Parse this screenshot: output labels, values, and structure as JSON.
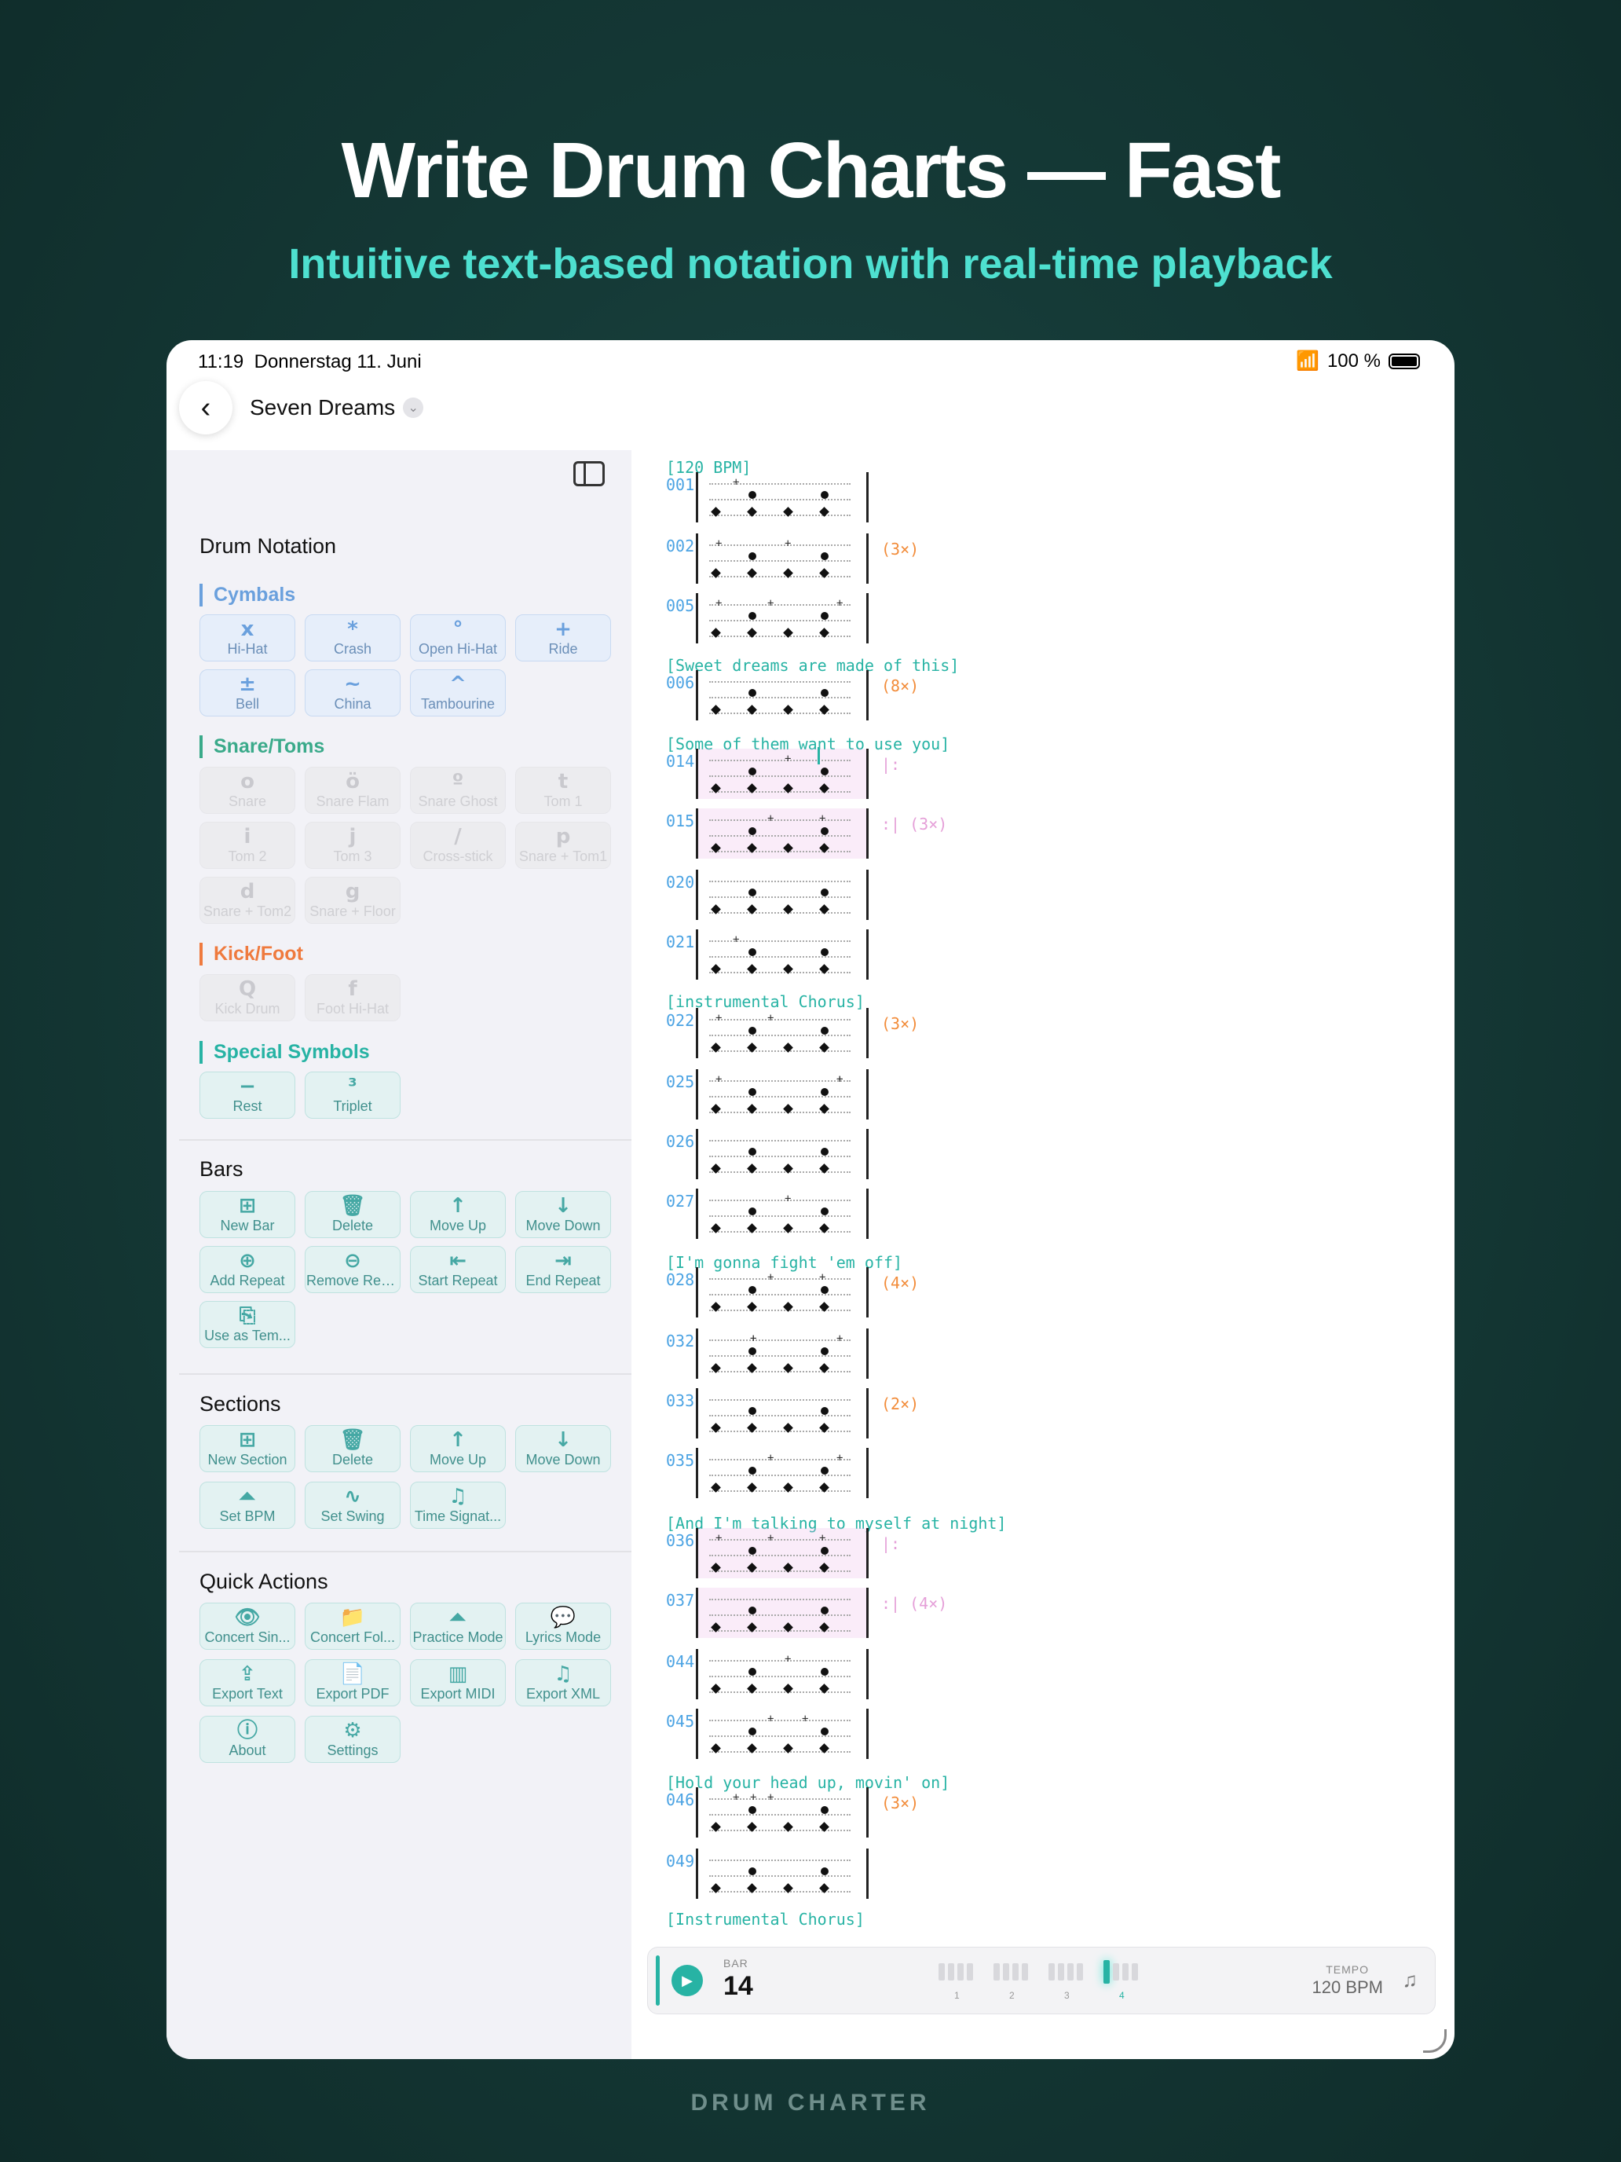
{
  "hero": {
    "title": "Write Drum Charts — Fast",
    "subtitle": "Intuitive text-based notation with real-time playback"
  },
  "brand": "DRUM CHARTER",
  "status": {
    "time": "11:19",
    "date": "Donnerstag 11. Juni",
    "battery": "100 %"
  },
  "document": {
    "title": "Seven Dreams"
  },
  "sidebar": {
    "notation_title": "Drum Notation",
    "cat_cymbals": "Cymbals",
    "cat_snare": "Snare/Toms",
    "cat_kick": "Kick/Foot",
    "cat_special": "Special Symbols",
    "cymbals": [
      {
        "g": "x",
        "l": "Hi-Hat"
      },
      {
        "g": "*",
        "l": "Crash"
      },
      {
        "g": "°",
        "l": "Open Hi-Hat"
      },
      {
        "g": "+",
        "l": "Ride"
      },
      {
        "g": "±",
        "l": "Bell"
      },
      {
        "g": "~",
        "l": "China"
      },
      {
        "g": "^",
        "l": "Tambourine"
      }
    ],
    "snare": [
      {
        "g": "o",
        "l": "Snare"
      },
      {
        "g": "ö",
        "l": "Snare Flam"
      },
      {
        "g": "º",
        "l": "Snare Ghost"
      },
      {
        "g": "t",
        "l": "Tom 1"
      },
      {
        "g": "i",
        "l": "Tom 2"
      },
      {
        "g": "j",
        "l": "Tom 3"
      },
      {
        "g": "/",
        "l": "Cross-stick"
      },
      {
        "g": "p",
        "l": "Snare + Tom1"
      },
      {
        "g": "d",
        "l": "Snare + Tom2"
      },
      {
        "g": "g",
        "l": "Snare + Floor"
      }
    ],
    "kick": [
      {
        "g": "Q",
        "l": "Kick Drum"
      },
      {
        "g": "f",
        "l": "Foot Hi-Hat"
      }
    ],
    "special": [
      {
        "g": "−",
        "l": "Rest"
      },
      {
        "g": "³",
        "l": "Triplet"
      }
    ],
    "bars_title": "Bars",
    "bars": [
      {
        "g": "⊞",
        "l": "New Bar"
      },
      {
        "g": "🗑",
        "l": "Delete"
      },
      {
        "g": "↑",
        "l": "Move Up"
      },
      {
        "g": "↓",
        "l": "Move Down"
      },
      {
        "g": "⊕",
        "l": "Add Repeat"
      },
      {
        "g": "⊖",
        "l": "Remove Rep..."
      },
      {
        "g": "⇤",
        "l": "Start Repeat"
      },
      {
        "g": "⇥",
        "l": "End Repeat"
      },
      {
        "g": "⎘",
        "l": "Use as Tem..."
      }
    ],
    "sections_title": "Sections",
    "sections": [
      {
        "g": "⊞",
        "l": "New Section"
      },
      {
        "g": "🗑",
        "l": "Delete"
      },
      {
        "g": "↑",
        "l": "Move Up"
      },
      {
        "g": "↓",
        "l": "Move Down"
      },
      {
        "g": "⏶",
        "l": "Set BPM"
      },
      {
        "g": "∿",
        "l": "Set Swing"
      },
      {
        "g": "♫",
        "l": "Time Signat..."
      }
    ],
    "quick_title": "Quick Actions",
    "quick": [
      {
        "g": "👁",
        "l": "Concert Sin..."
      },
      {
        "g": "📁",
        "l": "Concert Fol..."
      },
      {
        "g": "⏶",
        "l": "Practice Mode"
      },
      {
        "g": "💬",
        "l": "Lyrics Mode"
      },
      {
        "g": "⇪",
        "l": "Export Text"
      },
      {
        "g": "📄",
        "l": "Export PDF"
      },
      {
        "g": "▥",
        "l": "Export MIDI"
      },
      {
        "g": "♫",
        "l": "Export XML"
      },
      {
        "g": "ⓘ",
        "l": "About"
      },
      {
        "g": "⚙",
        "l": "Settings"
      }
    ]
  },
  "score": {
    "sections": [
      "[120 BPM]",
      "[Sweet dreams are made of this]",
      "[Some of them want to use you]",
      "[instrumental Chorus]",
      "[I'm gonna fight 'em off]",
      "[And I'm talking to myself at night]",
      "[Hold your head up, movin' on]",
      "[Instrumental Chorus]"
    ],
    "bars": [
      {
        "n": "001",
        "rep": ""
      },
      {
        "n": "002",
        "rep": "(3×)"
      },
      {
        "n": "005",
        "rep": ""
      },
      {
        "n": "006",
        "rep": "(8×)"
      },
      {
        "n": "014",
        "rep": "|:"
      },
      {
        "n": "015",
        "rep": ":| (3×)"
      },
      {
        "n": "020",
        "rep": ""
      },
      {
        "n": "021",
        "rep": ""
      },
      {
        "n": "022",
        "rep": "(3×)"
      },
      {
        "n": "025",
        "rep": ""
      },
      {
        "n": "026",
        "rep": ""
      },
      {
        "n": "027",
        "rep": ""
      },
      {
        "n": "028",
        "rep": "(4×)"
      },
      {
        "n": "032",
        "rep": ""
      },
      {
        "n": "033",
        "rep": "(2×)"
      },
      {
        "n": "035",
        "rep": ""
      },
      {
        "n": "036",
        "rep": "|:"
      },
      {
        "n": "037",
        "rep": ":| (4×)"
      },
      {
        "n": "044",
        "rep": ""
      },
      {
        "n": "045",
        "rep": ""
      },
      {
        "n": "046",
        "rep": "(3×)"
      },
      {
        "n": "049",
        "rep": ""
      }
    ]
  },
  "transport": {
    "bar_label": "BAR",
    "bar_value": "14",
    "tempo_label": "TEMPO",
    "tempo_value": "120 BPM",
    "beats": [
      "1",
      "2",
      "3",
      "4"
    ],
    "current_beat": 4
  }
}
